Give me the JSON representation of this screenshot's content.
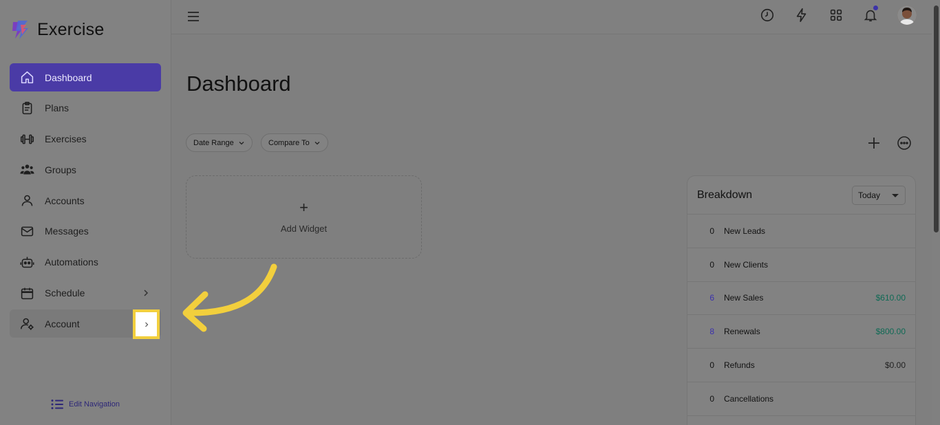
{
  "app": {
    "name": "Exercise"
  },
  "sidebar": {
    "items": [
      {
        "label": "Dashboard",
        "icon": "home-icon"
      },
      {
        "label": "Plans",
        "icon": "clipboard-icon"
      },
      {
        "label": "Exercises",
        "icon": "dumbbell-icon"
      },
      {
        "label": "Groups",
        "icon": "users-icon"
      },
      {
        "label": "Accounts",
        "icon": "user-icon"
      },
      {
        "label": "Messages",
        "icon": "mail-icon"
      },
      {
        "label": "Automations",
        "icon": "robot-icon"
      },
      {
        "label": "Schedule",
        "icon": "calendar-icon"
      },
      {
        "label": "Account",
        "icon": "user-gear-icon"
      }
    ],
    "edit_navigation": "Edit Navigation"
  },
  "main": {
    "title": "Dashboard",
    "filters": {
      "date_range": "Date Range",
      "compare_to": "Compare To"
    },
    "add_widget": {
      "plus": "+",
      "label": "Add Widget"
    }
  },
  "breakdown": {
    "title": "Breakdown",
    "period": "Today",
    "rows": [
      {
        "count": "0",
        "label": "New Leads",
        "amount": ""
      },
      {
        "count": "0",
        "label": "New Clients",
        "amount": ""
      },
      {
        "count": "6",
        "label": "New Sales",
        "amount": "$610.00"
      },
      {
        "count": "8",
        "label": "Renewals",
        "amount": "$800.00"
      },
      {
        "count": "0",
        "label": "Refunds",
        "amount": "$0.00"
      },
      {
        "count": "0",
        "label": "Cancellations",
        "amount": ""
      }
    ]
  },
  "colors": {
    "accent": "#4a3ba6",
    "highlight": "#f2cf3d",
    "money": "#0f6a55"
  }
}
